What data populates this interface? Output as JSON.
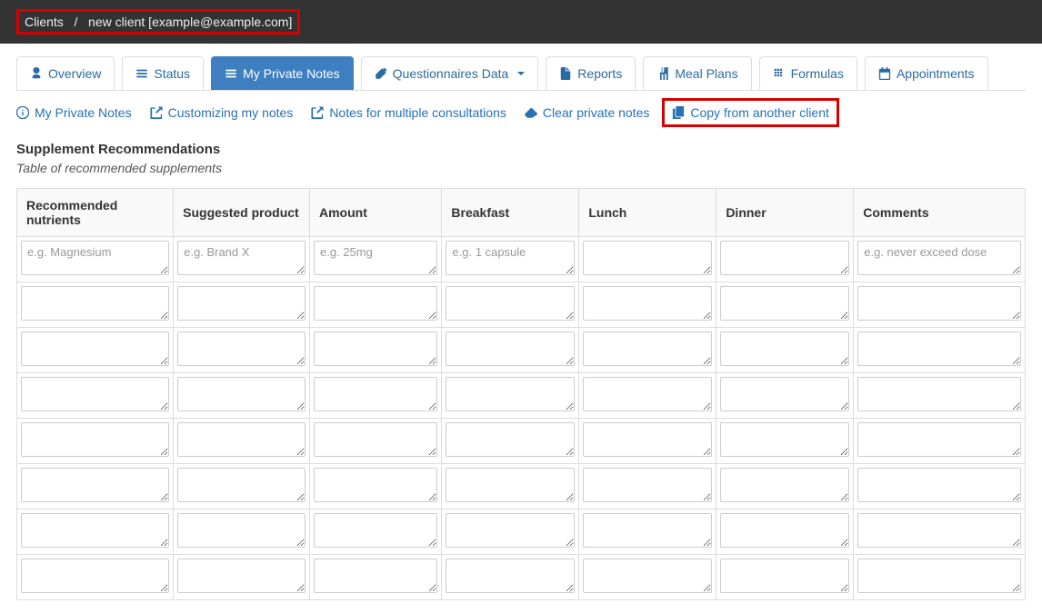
{
  "breadcrumb": {
    "root": "Clients",
    "sep": "/",
    "current": "new client [example@example.com]"
  },
  "tabs": {
    "overview": "Overview",
    "status": "Status",
    "notes": "My Private Notes",
    "questionnaires": "Questionnaires Data",
    "reports": "Reports",
    "meals": "Meal Plans",
    "formulas": "Formulas",
    "appointments": "Appointments"
  },
  "sublinks": {
    "info": "My Private Notes",
    "customizing": "Customizing my notes",
    "multiple": "Notes for multiple consultations",
    "clear": "Clear private notes",
    "copy": "Copy from another client"
  },
  "section": {
    "title": "Supplement Recommendations",
    "subtitle": "Table of recommended supplements"
  },
  "table": {
    "headers": {
      "nutrients": "Recommended nutrients",
      "product": "Suggested product",
      "amount": "Amount",
      "breakfast": "Breakfast",
      "lunch": "Lunch",
      "dinner": "Dinner",
      "comments": "Comments"
    },
    "placeholders": {
      "nutrients": "e.g. Magnesium",
      "product": "e.g. Brand X",
      "amount": "e.g. 25mg",
      "breakfast": "e.g. 1 capsule",
      "lunch": "",
      "dinner": "",
      "comments": "e.g. never exceed dose"
    },
    "row_count": 8
  }
}
